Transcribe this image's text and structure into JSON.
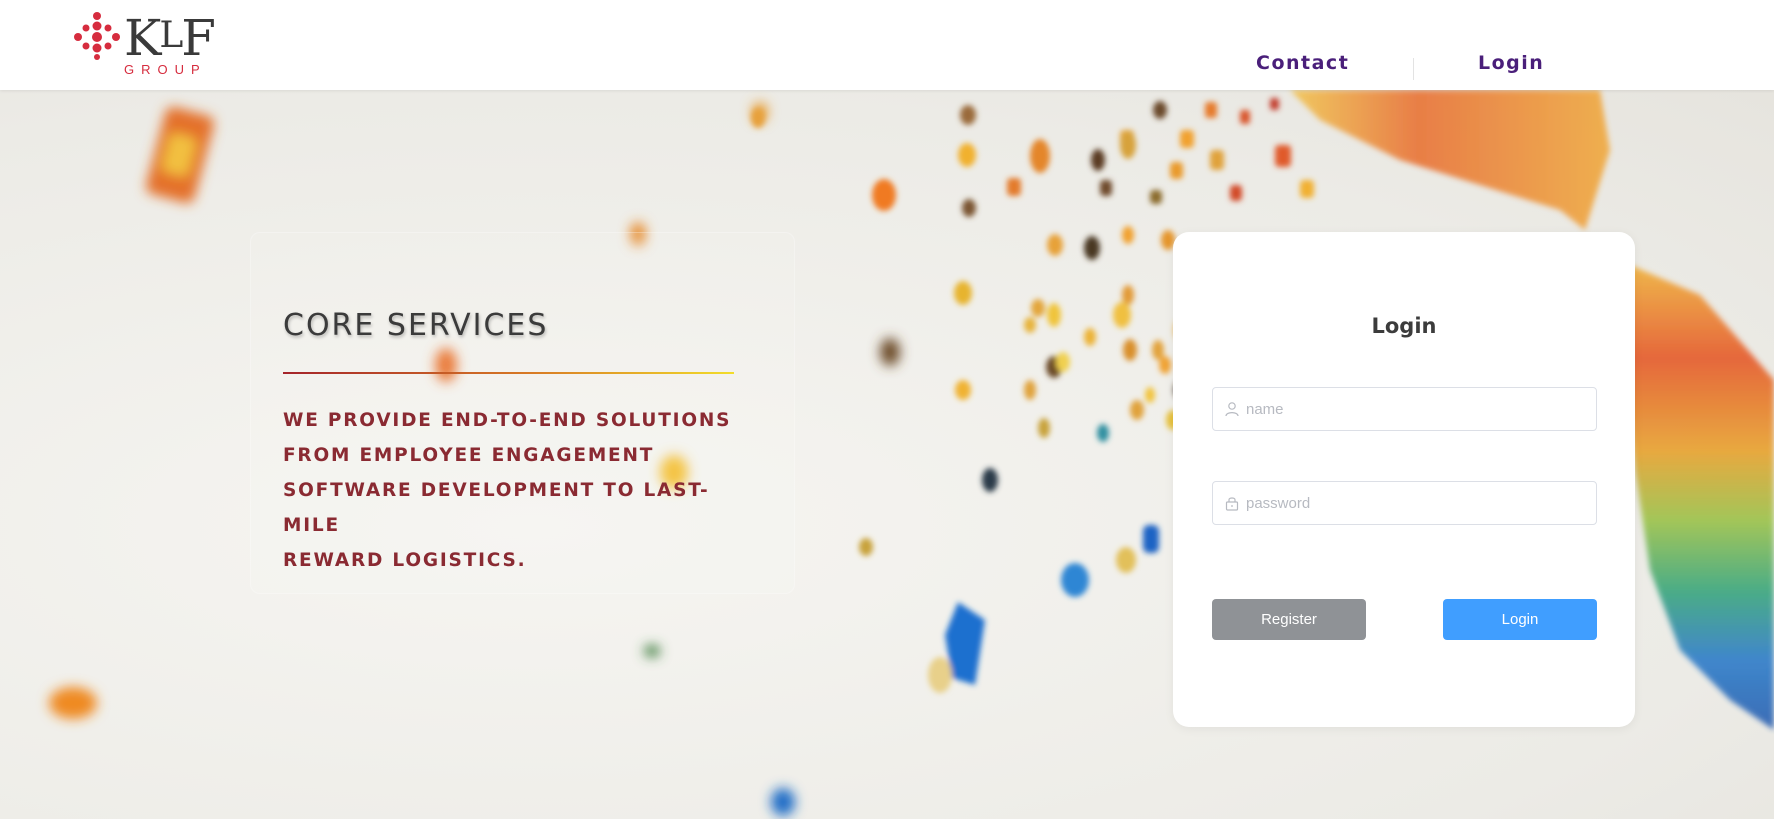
{
  "header": {
    "logo": {
      "wordmark": "KLF",
      "sub": "GROUP",
      "brand_color": "#d62c3e"
    },
    "nav": {
      "contact_label": "Contact",
      "login_label": "Login"
    },
    "nav_color": "#4a1f7a"
  },
  "services": {
    "title": "CORE SERVICES",
    "lines": [
      "WE PROVIDE END-TO-END SOLUTIONS",
      "FROM EMPLOYEE ENGAGEMENT",
      "SOFTWARE DEVELOPMENT TO LAST-MILE",
      "REWARD LOGISTICS."
    ],
    "text_color": "#8a2a32"
  },
  "login": {
    "title": "Login",
    "name_placeholder": "name",
    "password_placeholder": "password",
    "register_label": "Register",
    "login_label": "Login",
    "login_color": "#409eff",
    "register_color": "#8f9296"
  },
  "icons": {
    "name_field": "user-icon",
    "password_field": "lock-icon"
  }
}
